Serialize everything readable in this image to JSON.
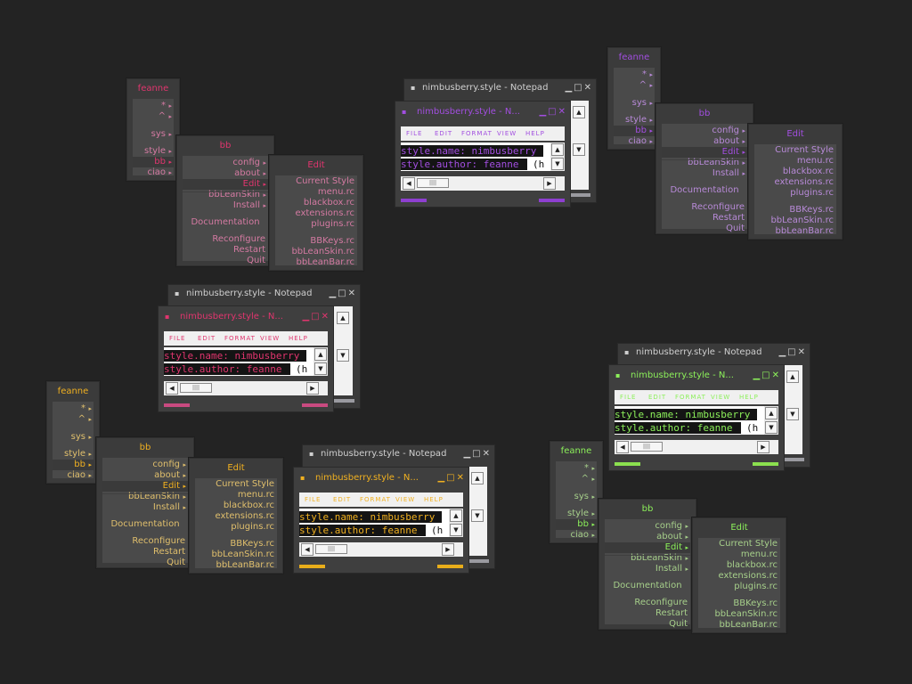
{
  "menu": {
    "root_title": "feanne",
    "root_items": [
      {
        "label": "*",
        "arrow": "▸"
      },
      {
        "label": "^",
        "arrow": "▸"
      },
      {
        "label": "sys",
        "arrow": "▸"
      },
      {
        "label": "style",
        "arrow": "▸"
      },
      {
        "label": "bb",
        "arrow": "▸"
      },
      {
        "label": "ciao",
        "arrow": "▸"
      }
    ],
    "bb_title": "bb",
    "bb_items": [
      {
        "label": "config",
        "arrow": "▸"
      },
      {
        "label": "about",
        "arrow": "▸"
      },
      {
        "label": "Edit",
        "arrow": "▸"
      },
      {
        "label": "bbLeanSkin",
        "arrow": "▸"
      },
      {
        "label": "Install",
        "arrow": "▸"
      },
      {
        "label": "Documentation",
        "arrow": ""
      },
      {
        "label": "Reconfigure",
        "arrow": ""
      },
      {
        "label": "Restart",
        "arrow": ""
      },
      {
        "label": "Quit",
        "arrow": ""
      }
    ],
    "edit_title": "Edit",
    "edit_items": [
      {
        "label": "Current Style"
      },
      {
        "label": "menu.rc"
      },
      {
        "label": "blackbox.rc"
      },
      {
        "label": "extensions.rc"
      },
      {
        "label": "plugins.rc"
      },
      {
        "label": "BBKeys.rc"
      },
      {
        "label": "bbLeanSkin.rc"
      },
      {
        "label": "bbLeanBar.rc"
      }
    ]
  },
  "notepad": {
    "back_title": "nimbusberry.style - Notepad",
    "front_title": "nimbusberry.style - N...",
    "title_icon": "▪",
    "buttons": {
      "minimize": "▁",
      "maximize": "□",
      "close": "✕"
    },
    "menus": [
      "FILE",
      "EDIT",
      "FORMAT",
      "VIEW",
      "HELP"
    ],
    "line1": "style.name: nimbusberry",
    "line2": "style.author: feanne",
    "line2_tail": "(h",
    "scroll_up": "▲",
    "scroll_down": "▼",
    "scroll_left": "◀",
    "scroll_right": "▶",
    "thumb": "||||"
  },
  "themes": [
    {
      "name": "pink",
      "accent": "#e0356e",
      "text": "#d47aa2",
      "status": "#c94a80",
      "ox": 0,
      "oy": 0
    },
    {
      "name": "purple",
      "accent": "#a24ee0",
      "text": "#b88ad8",
      "status": "#8e3fd0",
      "ox": 0,
      "oy": 0
    },
    {
      "name": "gold",
      "accent": "#f0b020",
      "text": "#e0bf6c",
      "status": "#e8ad1a",
      "ox": 0,
      "oy": 0
    },
    {
      "name": "green",
      "accent": "#8cf05a",
      "text": "#a6cf8a",
      "status": "#8be04f",
      "ox": 0,
      "oy": 0
    }
  ]
}
